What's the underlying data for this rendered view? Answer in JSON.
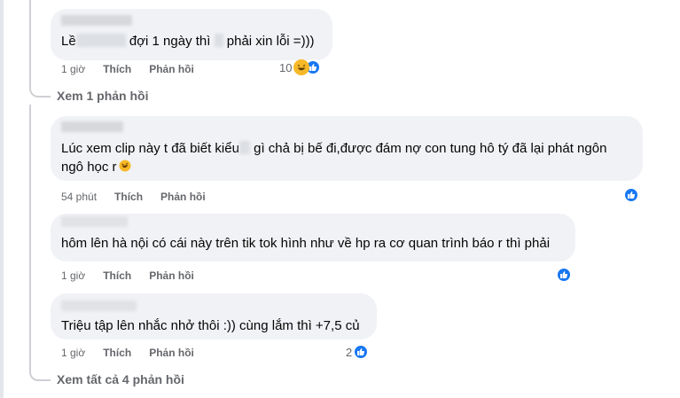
{
  "comments": [
    {
      "text_parts": [
        "Lề",
        "đợi 1 ngày thì",
        "phải xin lỗi =)))"
      ],
      "time": "1 giờ",
      "like_label": "Thích",
      "reply_label": "Phản hồi",
      "reaction_count": "10",
      "reactions": [
        "haha",
        "like"
      ]
    },
    {
      "text_line1_parts": [
        "Lúc xem clip này t đã biết kiểu",
        "gì chả bị bế đi,được đám nợ con tung hô tý đã lại phát ngôn"
      ],
      "text_line2": "ngô học r",
      "time": "54 phút",
      "like_label": "Thích",
      "reply_label": "Phản hồi",
      "reactions": [
        "like"
      ]
    },
    {
      "text": "hôm lên hà nội có cái này trên tik tok hình như về hp ra cơ quan trình báo r thì phải",
      "time": "1 giờ",
      "like_label": "Thích",
      "reply_label": "Phản hồi",
      "reactions": [
        "like"
      ]
    },
    {
      "text": "Triệu tập lên nhắc nhở thôi :)) cùng lắm thì +7,5 củ",
      "time": "1 giờ",
      "like_label": "Thích",
      "reply_label": "Phản hồi",
      "reaction_count": "2",
      "reactions": [
        "like"
      ]
    }
  ],
  "view_one_reply": "Xem 1 phản hồi",
  "view_all_replies": "Xem tất cả 4 phản hồi",
  "colors": {
    "bubble": "#f0f2f5",
    "meta": "#65676b",
    "like_blue": "#1877f2",
    "haha_yellow": "#f7b928"
  }
}
